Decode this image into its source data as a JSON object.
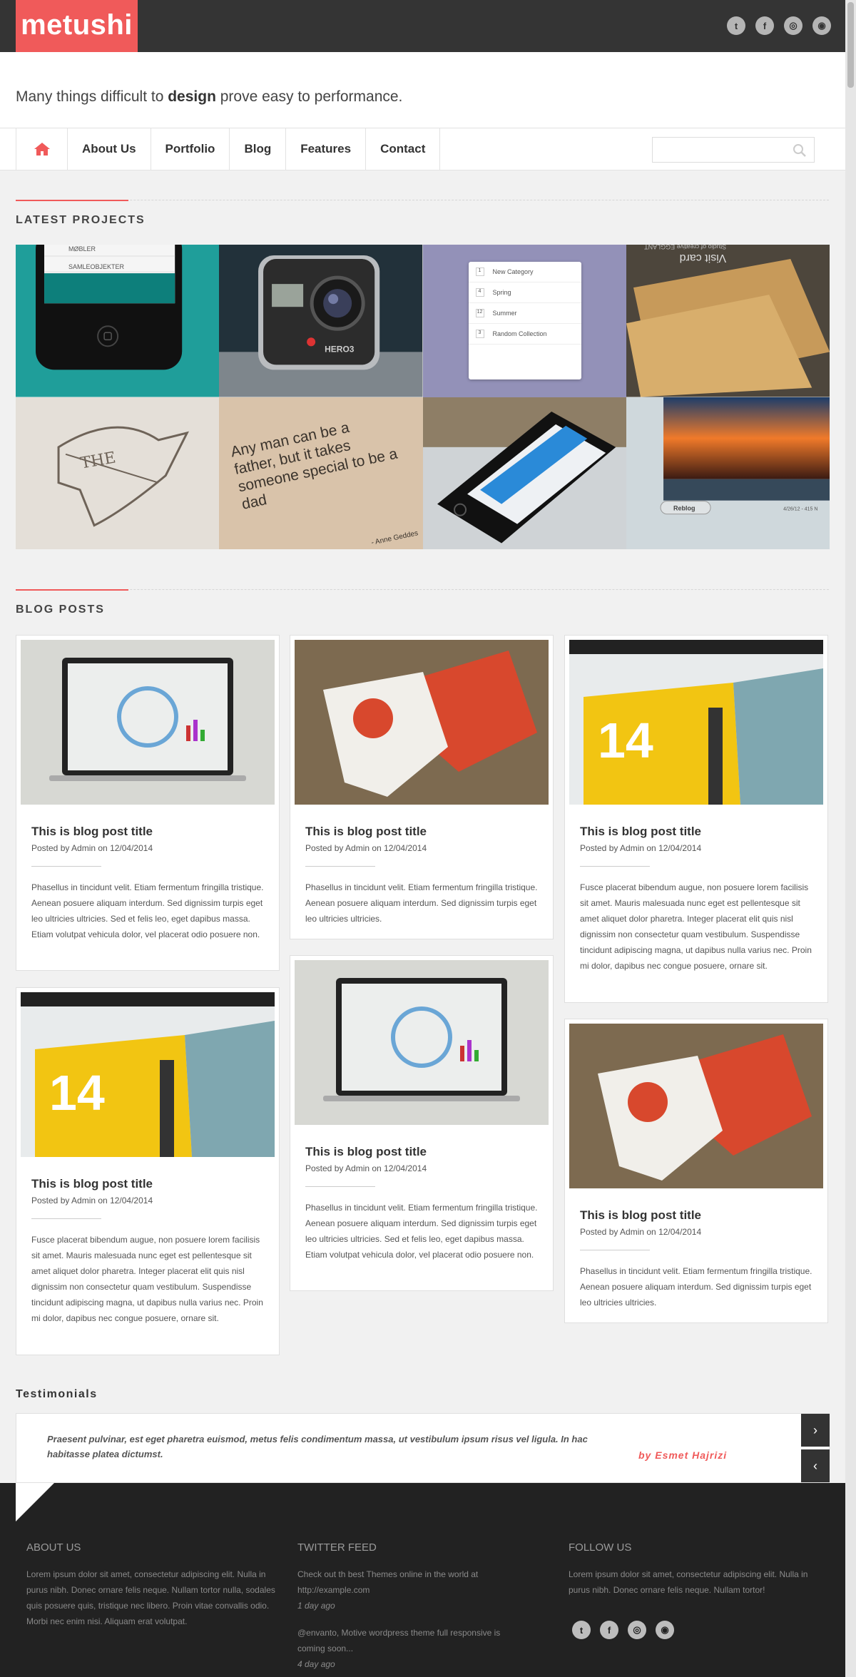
{
  "brand": {
    "name": "metushi",
    "accent": "#f05a5a"
  },
  "header": {
    "social": [
      {
        "icon": "twitter-icon",
        "glyph": "t"
      },
      {
        "icon": "facebook-icon",
        "glyph": "f"
      },
      {
        "icon": "dribbble-icon",
        "glyph": "◎"
      },
      {
        "icon": "rss-icon",
        "glyph": "◉"
      }
    ],
    "tagline_before": "Many things difficult to ",
    "tagline_bold": "design",
    "tagline_after": " prove easy to performance."
  },
  "nav": {
    "home_icon": "home-icon",
    "items": [
      "About Us",
      "Portfolio",
      "Blog",
      "Features",
      "Contact"
    ],
    "search_placeholder": ""
  },
  "projects": {
    "heading": "LATEST PROJECTS",
    "tiles": [
      {
        "id": "app-phone"
      },
      {
        "id": "action-camera",
        "label": "HERO3"
      },
      {
        "id": "category-list",
        "items": [
          "New Category",
          "Spring",
          "Summer",
          "Random Collection"
        ],
        "counts": [
          "1",
          "4",
          "12",
          "3"
        ]
      },
      {
        "id": "visit-card",
        "label": "Visit card",
        "sub": "Studio of creative EGGLANT"
      },
      {
        "id": "sketch",
        "label": "THE"
      },
      {
        "id": "quote",
        "label": "Any man can be a father, but it takes someone special to be a dad",
        "author": "- Anne Geddes"
      },
      {
        "id": "iphone"
      },
      {
        "id": "sunset",
        "label": "Reblog",
        "date": "4/26/12 - 415 N"
      }
    ]
  },
  "blog": {
    "heading": "BLOG POSTS",
    "posts": [
      {
        "image": "laptop",
        "title": "This is blog post title",
        "meta": "Posted by Admin on 12/04/2014",
        "excerpt": "Phasellus in tincidunt velit. Etiam fermentum fringilla tristique. Aenean posuere aliquam interdum. Sed dignissim turpis eget leo ultricies ultricies. Sed et felis leo, eget dapibus massa. Etiam volutpat vehicula dolor, vel placerat odio posuere non."
      },
      {
        "image": "cards",
        "title": "This is blog post title",
        "meta": "Posted by Admin on 12/04/2014",
        "excerpt": "Phasellus in tincidunt velit. Etiam fermentum fringilla tristique. Aenean posuere aliquam interdum. Sed dignissim turpis eget leo ultricies ultricies."
      },
      {
        "image": "calendar",
        "title": "This is blog post title",
        "meta": "Posted by Admin on 12/04/2014",
        "excerpt": "Fusce placerat bibendum augue, non posuere lorem facilisis sit amet. Mauris malesuada nunc eget est pellentesque sit amet aliquet dolor pharetra. Integer placerat elit quis nisl dignissim non consectetur quam vestibulum. Suspendisse tincidunt adipiscing magna, ut dapibus nulla varius nec. Proin mi dolor, dapibus nec congue posuere, ornare sit."
      },
      {
        "image": "calendar",
        "title": "This is blog post title",
        "meta": "Posted by Admin on 12/04/2014",
        "excerpt": "Fusce placerat bibendum augue, non posuere lorem facilisis sit amet. Mauris malesuada nunc eget est pellentesque sit amet aliquet dolor pharetra. Integer placerat elit quis nisl dignissim non consectetur quam vestibulum. Suspendisse tincidunt adipiscing magna, ut dapibus nulla varius nec. Proin mi dolor, dapibus nec congue posuere, ornare sit."
      },
      {
        "image": "laptop",
        "title": "This is blog post title",
        "meta": "Posted by Admin on 12/04/2014",
        "excerpt": "Phasellus in tincidunt velit. Etiam fermentum fringilla tristique. Aenean posuere aliquam interdum. Sed dignissim turpis eget leo ultricies ultricies. Sed et felis leo, eget dapibus massa. Etiam volutpat vehicula dolor, vel placerat odio posuere non."
      },
      {
        "image": "cards",
        "title": "This is blog post title",
        "meta": "Posted by Admin on 12/04/2014",
        "excerpt": "Phasellus in tincidunt velit. Etiam fermentum fringilla tristique. Aenean posuere aliquam interdum. Sed dignissim turpis eget leo ultricies ultricies."
      }
    ]
  },
  "testimonials": {
    "heading": "Testimonials",
    "quote": "Praesent pulvinar, est eget pharetra euismod, metus felis condimentum massa, ut vestibulum ipsum risus vel ligula.  In hac habitasse platea dictumst.",
    "author": "by Esmet Hajrizi",
    "next_icon": "chevron-right-icon",
    "prev_icon": "chevron-left-icon"
  },
  "footer": {
    "about": {
      "heading": "ABOUT US",
      "text": "Lorem ipsum dolor sit amet, consectetur adipiscing elit. Nulla in purus nibh. Donec ornare felis neque. Nullam tortor nulla, sodales quis posuere quis, tristique nec libero. Proin vitae convallis odio. Morbi nec enim nisi. Aliquam erat volutpat."
    },
    "twitter": {
      "heading": "TWITTER FEED",
      "tweets": [
        {
          "text": "Check out th best Themes online in the world at http://example.com",
          "ago": "1 day ago"
        },
        {
          "text": "@envanto, Motive wordpress theme full responsive is coming soon...",
          "ago": "4 day ago"
        }
      ]
    },
    "follow": {
      "heading": "FOLLOW US",
      "text": "Lorem ipsum dolor sit amet, consectetur adipiscing elit. Nulla in purus nibh. Donec ornare felis neque. Nullam tortor!"
    }
  }
}
